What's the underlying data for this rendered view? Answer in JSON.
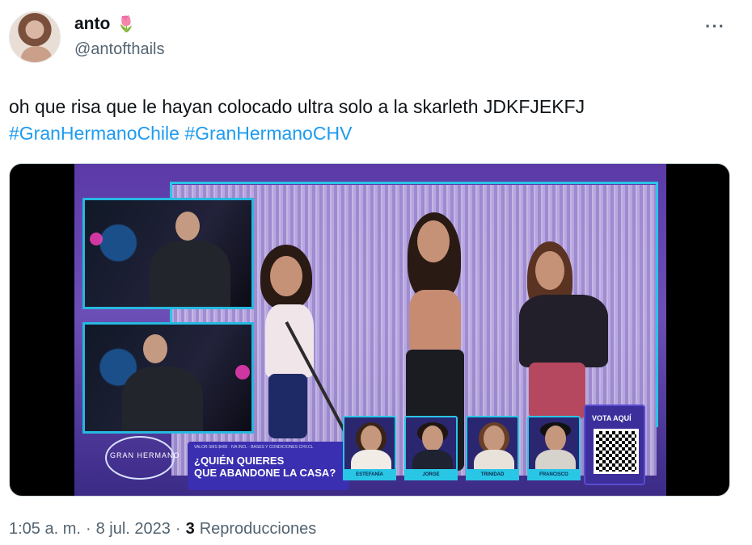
{
  "author": {
    "display_name": "anto",
    "emoji": "🌷",
    "handle": "@antofthails"
  },
  "actions": {
    "more_label": "···"
  },
  "tweet": {
    "text": "oh que risa que le hayan colocado ultra solo a la skarleth JDKFJEKFJ",
    "hashtags": [
      "#GranHermanoChile",
      "#GranHermanoCHV"
    ]
  },
  "media": {
    "overlay": {
      "logo_text": "GRAN HERMANO",
      "question_small": "VALOR SMS $400 · IVA INCL · BASES Y CONDICIONES CHV.CL",
      "question_line1": "¿QUIÉN QUIERES",
      "question_line2": "QUE ABANDONE LA CASA?",
      "vote_label": "VOTA AQUÍ",
      "nominees": [
        "ESTEFANÍA",
        "JORGE",
        "TRINIDAD",
        "FRANCISCO"
      ]
    },
    "colors": {
      "frame": "#29c6e6",
      "overlay_bg": "#3a2fb0"
    }
  },
  "meta": {
    "time": "1:05 a. m.",
    "separator": "·",
    "date": "8 jul. 2023",
    "views_count": "3",
    "views_label": "Reproducciones"
  }
}
